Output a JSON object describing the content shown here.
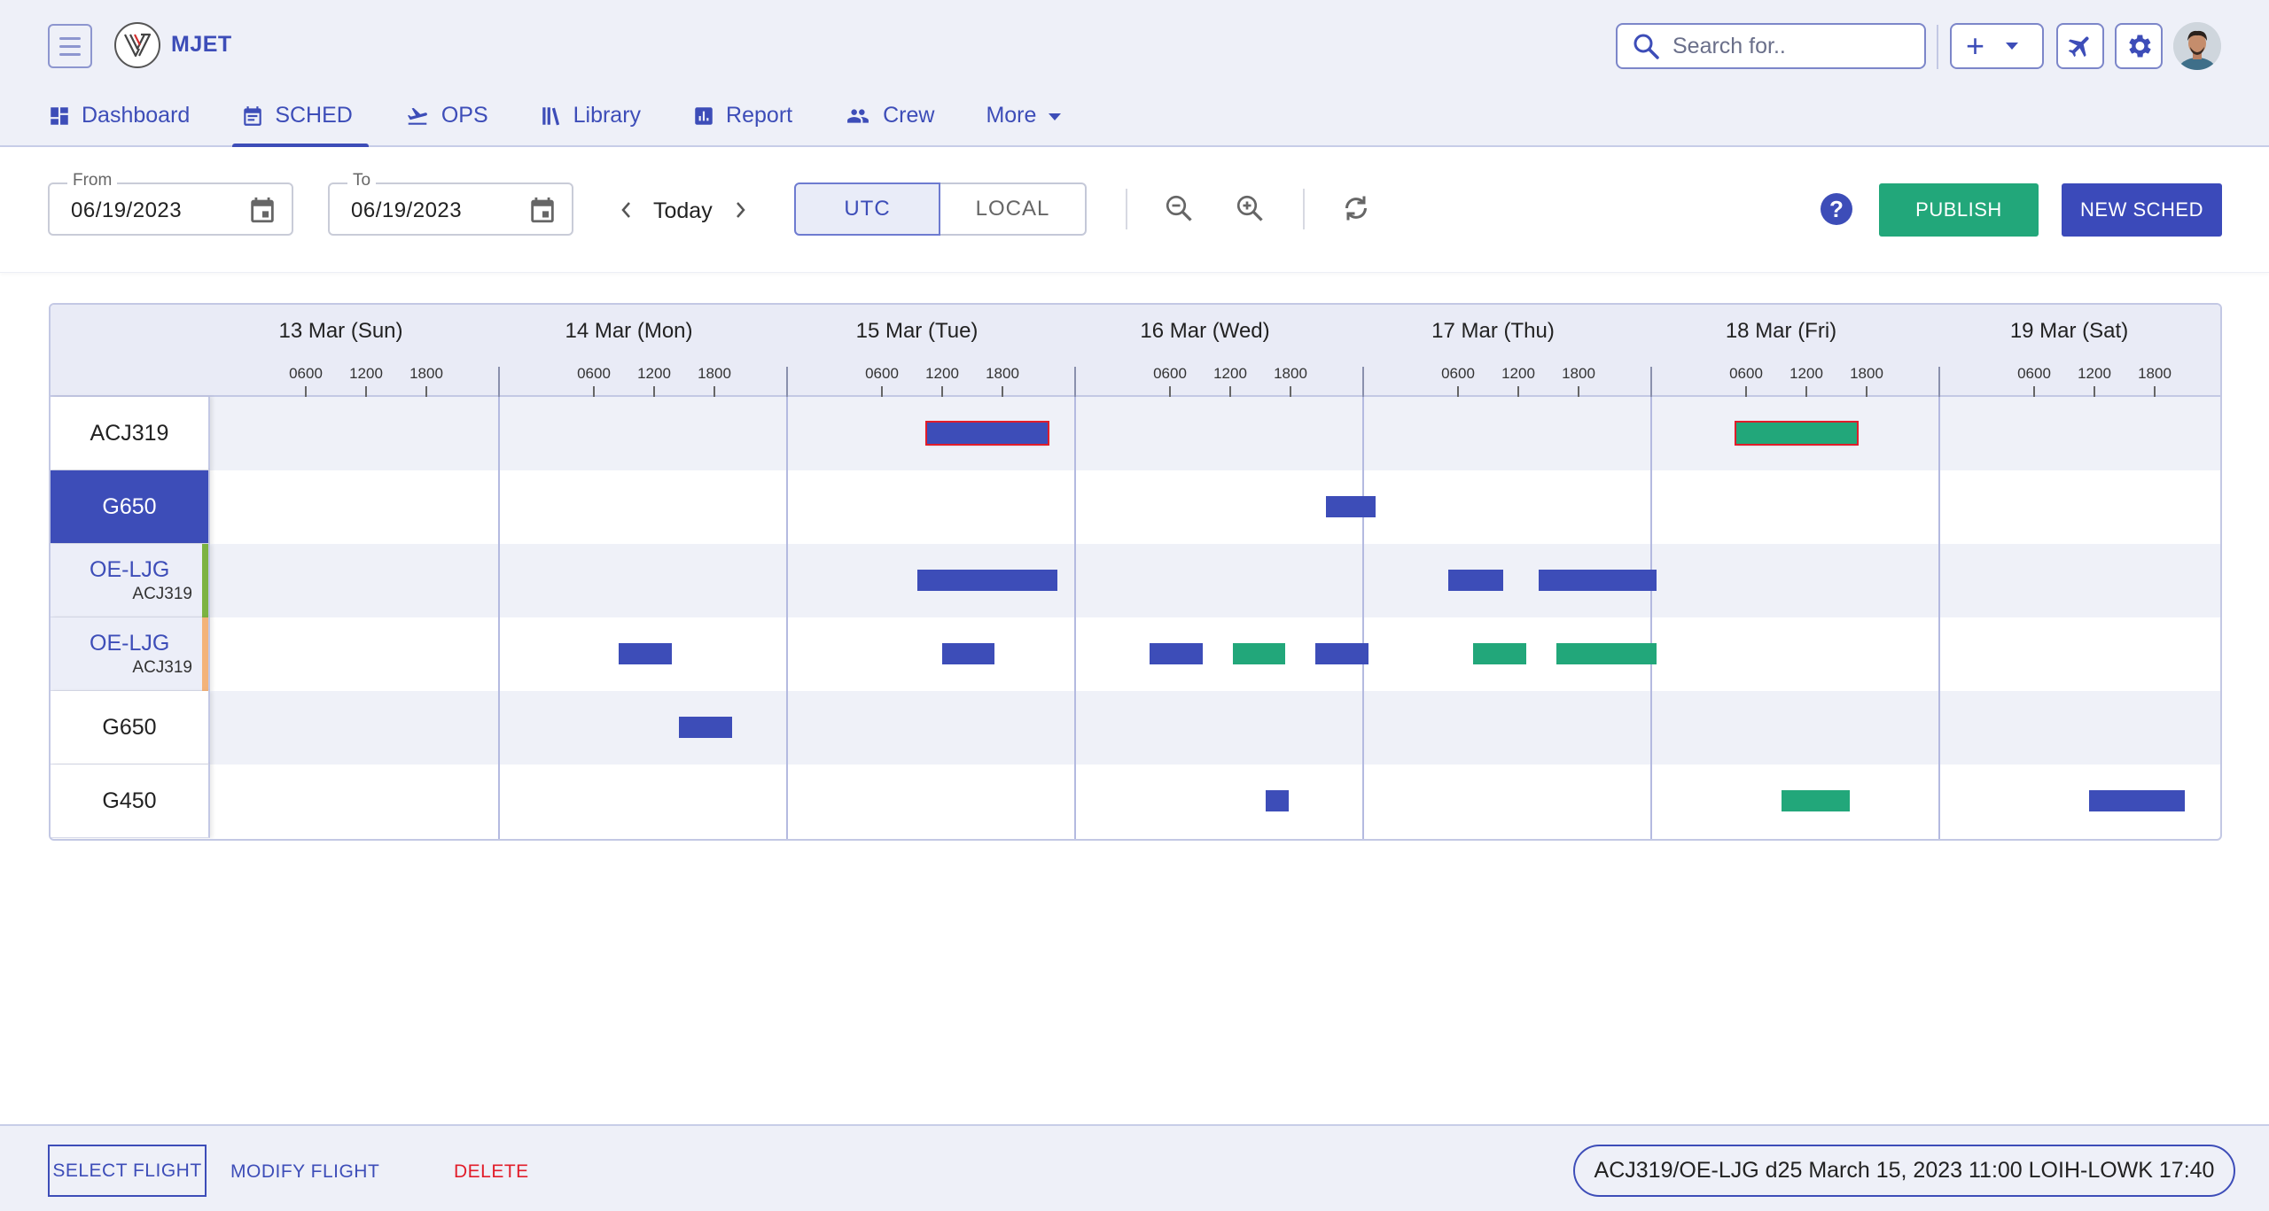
{
  "app": {
    "name": "MJET"
  },
  "header": {
    "search_placeholder": "Search for..",
    "nav": [
      {
        "label": "Dashboard",
        "icon": "dashboard-icon"
      },
      {
        "label": "SCHED",
        "icon": "calendar-icon",
        "active": true
      },
      {
        "label": "OPS",
        "icon": "plane-takeoff-icon"
      },
      {
        "label": "Library",
        "icon": "library-icon"
      },
      {
        "label": "Report",
        "icon": "report-icon"
      },
      {
        "label": "Crew",
        "icon": "crew-icon"
      },
      {
        "label": "More",
        "icon": "chevron-down-icon"
      }
    ]
  },
  "toolbar": {
    "from_label": "From",
    "from_value": "06/19/2023",
    "to_label": "To",
    "to_value": "06/19/2023",
    "today_label": "Today",
    "tz_options": [
      "UTC",
      "LOCAL"
    ],
    "tz_selected": "UTC",
    "publish_label": "PUBLISH",
    "new_sched_label": "NEW SCHED"
  },
  "schedule": {
    "days": [
      "13 Mar (Sun)",
      "14 Mar (Mon)",
      "15 Mar (Tue)",
      "16 Mar (Wed)",
      "17 Mar (Thu)",
      "18 Mar (Fri)",
      "19 Mar (Sat)"
    ],
    "ticks": [
      "0600",
      "1200",
      "1800"
    ],
    "rows": [
      {
        "name": "ACJ319",
        "sub": ""
      },
      {
        "name": "G650",
        "sub": "",
        "selected": true
      },
      {
        "name": "OE-LJG",
        "sub": "ACJ319",
        "stripe": "green"
      },
      {
        "name": "OE-LJG",
        "sub": "ACJ319",
        "stripe": "orange"
      },
      {
        "name": "G650",
        "sub": ""
      },
      {
        "name": "G450",
        "sub": ""
      }
    ],
    "flights": [
      {
        "row": 0,
        "day": 2,
        "start": 10.5,
        "end": 22.5,
        "status": "scheduled",
        "selected": true
      },
      {
        "row": 0,
        "day": 5,
        "start": 5.0,
        "end": 17.0,
        "status": "published",
        "selected": true
      },
      {
        "row": 1,
        "day": 3,
        "start": 21.5,
        "end": 26.5,
        "status": "scheduled"
      },
      {
        "row": 2,
        "day": 2,
        "start": 9.5,
        "end": 23.5,
        "status": "scheduled"
      },
      {
        "row": 2,
        "day": 4,
        "start": 5.0,
        "end": 10.5,
        "status": "scheduled"
      },
      {
        "row": 2,
        "day": 4,
        "start": 14.0,
        "end": 25.8,
        "status": "scheduled"
      },
      {
        "row": 3,
        "day": 1,
        "start": 8.5,
        "end": 13.8,
        "status": "scheduled"
      },
      {
        "row": 3,
        "day": 2,
        "start": 12.0,
        "end": 17.2,
        "status": "scheduled"
      },
      {
        "row": 3,
        "day": 3,
        "start": 4.0,
        "end": 9.3,
        "status": "scheduled"
      },
      {
        "row": 3,
        "day": 3,
        "start": 12.3,
        "end": 17.5,
        "status": "published"
      },
      {
        "row": 3,
        "day": 3,
        "start": 20.5,
        "end": 25.8,
        "status": "scheduled"
      },
      {
        "row": 3,
        "day": 4,
        "start": 7.5,
        "end": 12.8,
        "status": "published"
      },
      {
        "row": 3,
        "day": 4,
        "start": 15.8,
        "end": 25.8,
        "status": "published"
      },
      {
        "row": 4,
        "day": 1,
        "start": 14.5,
        "end": 19.8,
        "status": "scheduled"
      },
      {
        "row": 5,
        "day": 3,
        "start": 15.5,
        "end": 17.8,
        "status": "scheduled"
      },
      {
        "row": 5,
        "day": 5,
        "start": 9.5,
        "end": 16.3,
        "status": "published"
      },
      {
        "row": 5,
        "day": 6,
        "start": 11.5,
        "end": 21.0,
        "status": "scheduled"
      }
    ]
  },
  "footer": {
    "select_label": "SELECT FLIGHT",
    "modify_label": "MODIFY FLIGHT",
    "delete_label": "DELETE",
    "status_text": "ACJ319/OE-LJG d25 March 15, 2023 11:00 LOIH-LOWK 17:40"
  },
  "colors": {
    "primary": "#3d4db8",
    "published": "#22a77a",
    "selected_outline": "#e11d2a",
    "stripe_green": "#7cb342",
    "stripe_orange": "#f3b37a"
  }
}
